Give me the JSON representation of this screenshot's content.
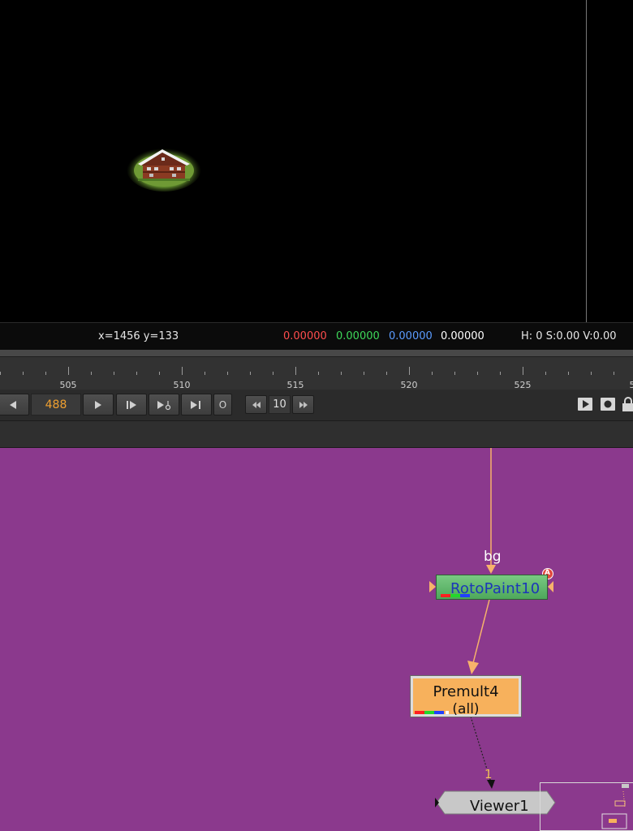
{
  "viewer": {
    "coords": "x=1456 y=133",
    "pixel": {
      "r": "0.00000",
      "g": "0.00000",
      "b": "0.00000",
      "a": "0.00000"
    },
    "hsv": "H:  0 S:0.00 V:0.00"
  },
  "timeline": {
    "tick_labels": [
      "505",
      "510",
      "515",
      "520",
      "525",
      "5"
    ]
  },
  "transport": {
    "current_frame": "488",
    "in_out_label": "O",
    "step": "10"
  },
  "nodegraph": {
    "bg_input_label": "bg",
    "rotopaint_name": "RotoPaint10",
    "rotopaint_badge": "A",
    "premult_name": "Premult4",
    "premult_channels": "(all)",
    "viewer_input_label": "1",
    "viewer_name": "Viewer1"
  },
  "colors": {
    "nodegraph_bg": "#8b398d",
    "pipe": "#f7b36b",
    "rotopaint_node": "#5fb86b",
    "premult_node": "#f7b15c",
    "viewer_node": "#c8c8c8",
    "frame_number": "#f0a030"
  }
}
